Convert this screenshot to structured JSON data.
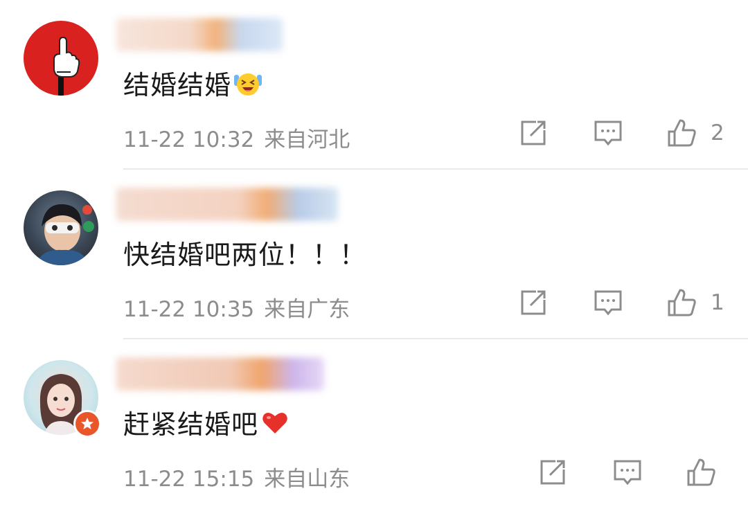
{
  "comments": [
    {
      "text": "结婚结婚",
      "emoji": "laughing-crying-face",
      "time": "11-22 10:32",
      "location": "来自河北",
      "likes": "2"
    },
    {
      "text": "快结婚吧两位！！！",
      "time": "11-22 10:35",
      "location": "来自广东",
      "likes": "1"
    },
    {
      "text": "赶紧结婚吧",
      "emoji": "red-heart",
      "time": "11-22 15:15",
      "location": "来自山东",
      "likes": ""
    }
  ],
  "icons": {
    "repost": "repost-icon",
    "comment": "comment-icon",
    "like": "like-icon",
    "badge": "star-badge-icon"
  },
  "colors": {
    "text": "#1a1a1a",
    "meta": "#8c8c8c",
    "icon": "#8c8c8c",
    "divider": "#e9e9e9",
    "heart": "#e8302a"
  }
}
